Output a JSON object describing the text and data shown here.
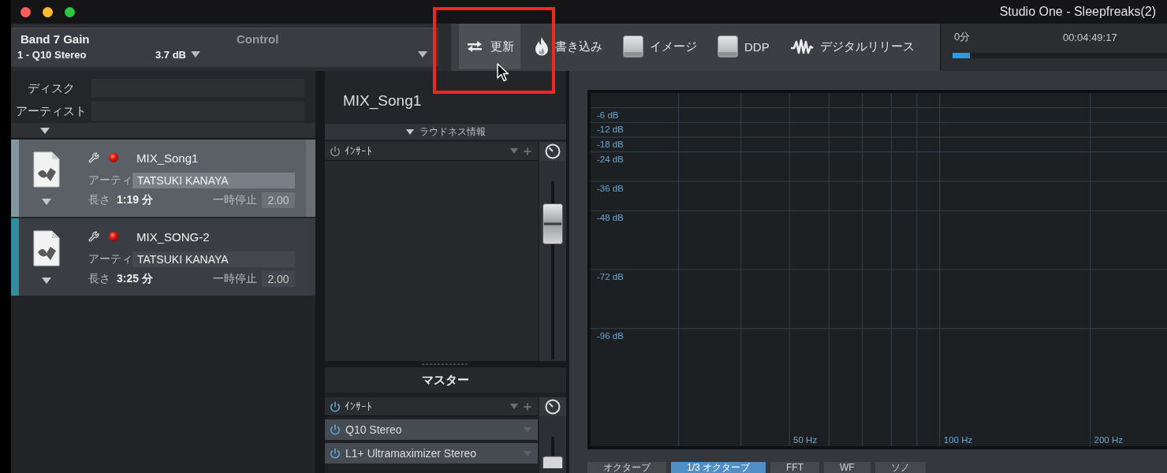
{
  "window": {
    "title": "Studio One - Sleepfreaks(2)"
  },
  "control_bar": {
    "parameter": "Band 7 Gain",
    "label": "Control",
    "device": "1 - Q10 Stereo",
    "value": "3.7 dB"
  },
  "toolbar": {
    "buttons": [
      {
        "kind": "update",
        "label": "更新",
        "highlighted": true
      },
      {
        "kind": "burn",
        "label": "書き込み",
        "highlighted": false
      },
      {
        "kind": "disc",
        "label": "イメージ",
        "highlighted": false
      },
      {
        "kind": "disc",
        "label": "DDP",
        "highlighted": false
      },
      {
        "kind": "release",
        "label": "デジタルリリース",
        "highlighted": false
      }
    ]
  },
  "transport": {
    "start": "0分",
    "time": "00:04:49:17",
    "progress": {
      "level": 0.08
    }
  },
  "disc_info": {
    "fields": [
      {
        "label": "ディスク"
      },
      {
        "label": "アーティスト"
      }
    ]
  },
  "tracks": [
    {
      "name": "MIX_Song1",
      "selected": true,
      "artist_label": "アーティ",
      "artist": "TATSUKI KANAYA",
      "length_label": "長さ",
      "length": "1:19 分",
      "pause_label": "一時停止",
      "pause": "2.00"
    },
    {
      "name": "MIX_SONG-2",
      "selected": false,
      "artist_label": "アーティ",
      "artist": "TATSUKI KANAYA",
      "length_label": "長さ",
      "length": "3:25 分",
      "pause_label": "一時停止",
      "pause": "2.00"
    }
  ],
  "track_detail": {
    "title": "MIX_Song1",
    "loudness_label": "ラウドネス情報",
    "inserts": {
      "label": "ｲﾝｻｰﾄ",
      "power_on": false
    },
    "fader": {
      "level": 0.84
    }
  },
  "master": {
    "title": "マスター",
    "inserts": {
      "label": "ｲﾝｻｰﾄ",
      "power_on": true,
      "items": [
        {
          "name": "Q10 Stereo",
          "on": true
        },
        {
          "name": "L1+ Ultramaximizer Stereo",
          "on": true
        }
      ]
    }
  },
  "analyzer": {
    "level_labels": [
      "-6 dB",
      "-12 dB",
      "-18 dB",
      "-24 dB",
      "-36 dB",
      "-48 dB",
      "-72 dB",
      "-96 dB"
    ],
    "frequency_labels": [
      "50 Hz",
      "100 Hz",
      "200 Hz"
    ],
    "tabs": [
      {
        "label": "オクターブ",
        "selected": false
      },
      {
        "label": "1/3 オクターブ",
        "selected": true
      },
      {
        "label": "FFT",
        "selected": false
      },
      {
        "label": "WF",
        "selected": false
      },
      {
        "label": "ソノ",
        "selected": false
      }
    ]
  }
}
